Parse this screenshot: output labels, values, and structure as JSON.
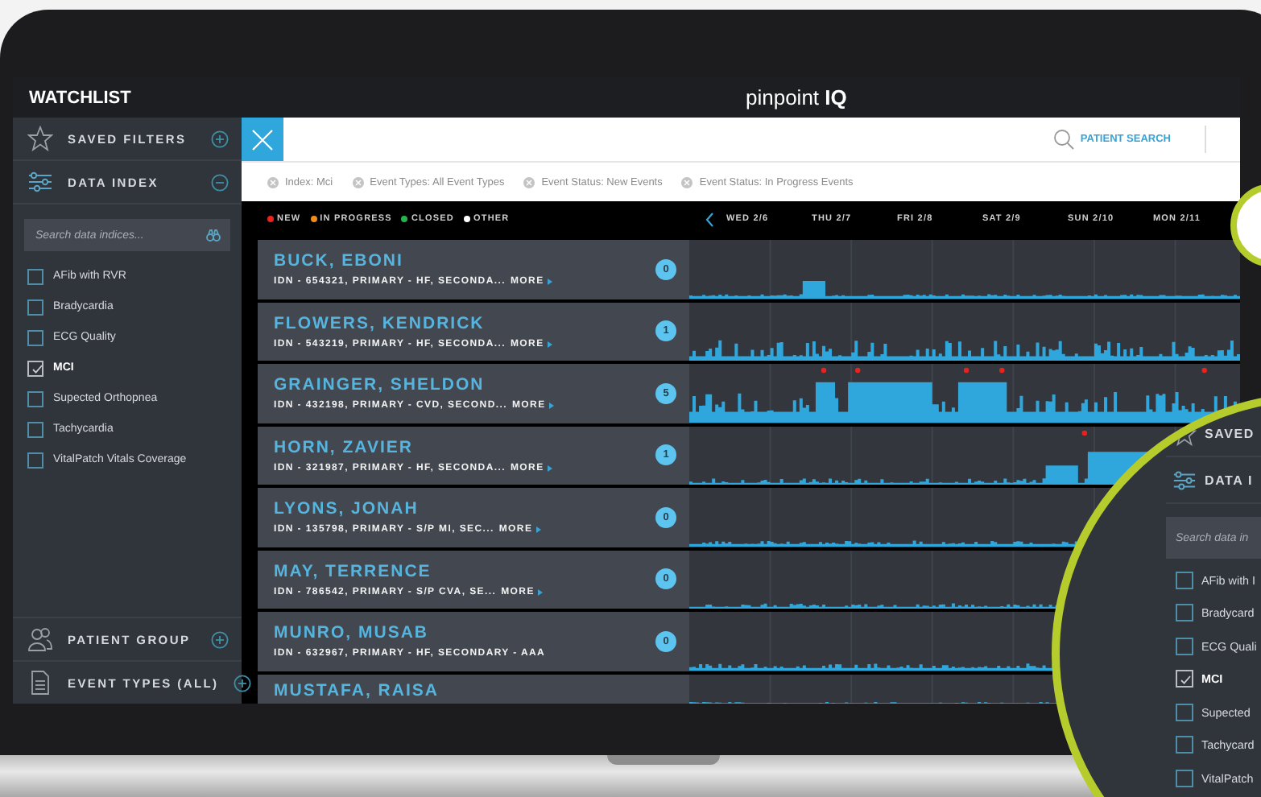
{
  "header": {
    "title": "WATCHLIST",
    "logo": "pinpoint **IQ**"
  },
  "sidebar": {
    "sections_top": [
      {
        "label": "SAVED FILTERS",
        "kind": "star",
        "expanded": false
      },
      {
        "label": "DATA INDEX",
        "kind": "sliders",
        "expanded": true
      }
    ],
    "search": {
      "placeholder": "Search data indices..."
    },
    "indices": [
      {
        "label": "AFib with RVR",
        "checked": false
      },
      {
        "label": "Bradycardia",
        "checked": false
      },
      {
        "label": "ECG Quality",
        "checked": false
      },
      {
        "label": "MCI",
        "checked": true
      },
      {
        "label": "Supected Orthopnea",
        "checked": false
      },
      {
        "label": "Tachycardia",
        "checked": false
      },
      {
        "label": "VitalPatch Vitals Coverage",
        "checked": false
      }
    ],
    "sections_bottom": [
      {
        "label": "PATIENT GROUP",
        "kind": "group",
        "expanded": false
      },
      {
        "label": "EVENT TYPES (ALL)",
        "kind": "document",
        "expanded": false
      }
    ]
  },
  "toolbar": {
    "patient_search": "PATIENT SEARCH"
  },
  "filters": [
    "Index: Mci",
    "Event Types: All Event Types",
    "Event Status: New Events",
    "Event Status: In Progress Events"
  ],
  "legend": [
    {
      "label": "NEW",
      "color": "#e8231f"
    },
    {
      "label": "IN PROGRESS",
      "color": "#f08c1a"
    },
    {
      "label": "CLOSED",
      "color": "#27b34b"
    },
    {
      "label": "OTHER",
      "color": "#ffffff"
    }
  ],
  "timeline": {
    "days": [
      "WED 2/6",
      "THU 2/7",
      "FRI 2/8",
      "SAT 2/9",
      "SUN 2/10",
      "MON 2/11"
    ]
  },
  "patients": [
    {
      "name": "BUCK, EBONI",
      "details": "IDN - 654321, PRIMARY - HF, SECONDA...",
      "more": "MORE",
      "count": "0"
    },
    {
      "name": "FLOWERS, KENDRICK",
      "details": "IDN - 543219, PRIMARY - HF, SECONDA...",
      "more": "MORE",
      "count": "1"
    },
    {
      "name": "GRAINGER, SHELDON",
      "details": "IDN - 432198, PRIMARY - CVD, SECOND...",
      "more": "MORE",
      "count": "5"
    },
    {
      "name": "HORN, ZAVIER",
      "details": "IDN - 321987, PRIMARY - HF, SECONDA...",
      "more": "MORE",
      "count": "1"
    },
    {
      "name": "LYONS, JONAH",
      "details": "IDN - 135798, PRIMARY - S/P MI, SEC...",
      "more": "MORE",
      "count": "0"
    },
    {
      "name": "MAY, TERRENCE",
      "details": "IDN - 786542, PRIMARY - S/P CVA, SE...",
      "more": "MORE",
      "count": "0"
    },
    {
      "name": "MUNRO, MUSAB",
      "details": "IDN - 632967, PRIMARY - HF, SECONDARY - AAA",
      "count": "0"
    },
    {
      "name": "MUSTAFA, RAISA"
    }
  ],
  "magnifier": {
    "sections": [
      {
        "label": "SAVED",
        "kind": "star"
      },
      {
        "label": "DATA I",
        "kind": "sliders"
      }
    ],
    "search": {
      "placeholder": "Search data in"
    },
    "indices": [
      {
        "label": "AFib with I",
        "checked": false
      },
      {
        "label": "Bradycard",
        "checked": false
      },
      {
        "label": "ECG Quali",
        "checked": false
      },
      {
        "label": "MCI",
        "checked": true
      },
      {
        "label": "Supected",
        "checked": false
      },
      {
        "label": "Tachycard",
        "checked": false
      },
      {
        "label": "VitalPatch",
        "checked": false
      }
    ]
  }
}
